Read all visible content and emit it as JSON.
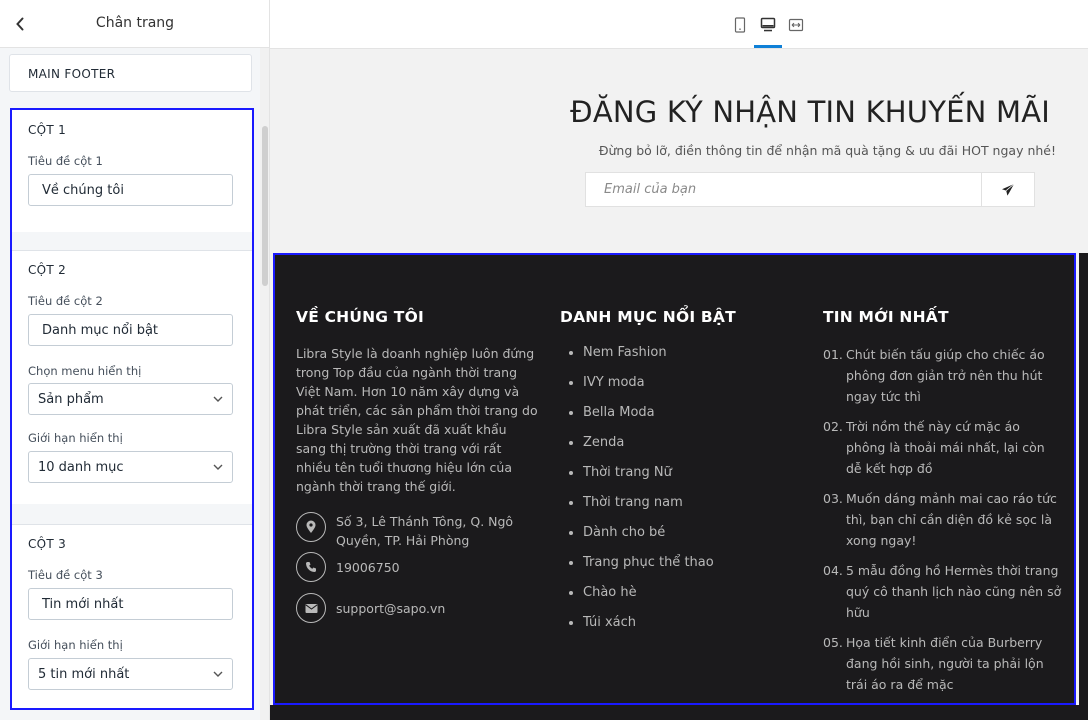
{
  "panel": {
    "title": "Chân trang",
    "main_footer_label": "MAIN FOOTER",
    "columns": [
      {
        "title": "CỘT 1",
        "title_label": "Tiêu đề cột 1",
        "title_value": "Về chúng tôi"
      },
      {
        "title": "CỘT 2",
        "title_label": "Tiêu đề cột 2",
        "title_value": "Danh mục nổi bật",
        "menu_label": "Chọn menu hiển thị",
        "menu_value": "Sản phẩm",
        "limit_label": "Giới hạn hiển thị",
        "limit_value": "10 danh mục"
      },
      {
        "title": "CỘT 3",
        "title_label": "Tiêu đề cột 3",
        "title_value": "Tin mới nhất",
        "limit_label": "Giới hạn hiển thị",
        "limit_value": "5 tin mới nhất"
      }
    ]
  },
  "device_bar": {
    "icons": [
      "mobile-icon",
      "desktop-icon",
      "fullwidth-icon"
    ],
    "active": "desktop-icon"
  },
  "newsletter": {
    "title": "ĐĂNG KÝ NHẬN TIN KHUYẾN MÃI",
    "subtitle": "Đừng bỏ lỡ, điền thông tin để nhận mã quà tặng & ưu đãi HOT ngay nhé!",
    "email_placeholder": "Email của bạn"
  },
  "footer": {
    "about": {
      "heading": "VỀ CHÚNG TÔI",
      "text": "Libra Style là doanh nghiệp luôn đứng trong Top đầu của ngành thời trang Việt Nam. Hơn 10 năm xây dựng và phát triển, các sản phẩm thời trang do Libra Style sản xuất đã xuất khẩu sang thị trường thời trang với rất nhiều tên tuổi thương hiệu lớn của ngành thời trang thế giới.",
      "address": "Số 3, Lê Thánh Tông, Q. Ngô Quyền, TP. Hải Phòng",
      "phone": "19006750",
      "email": "support@sapo.vn"
    },
    "categories": {
      "heading": "DANH MỤC NỔI BẬT",
      "items": [
        "Nem Fashion",
        "IVY moda",
        "Bella Moda",
        "Zenda",
        "Thời trang Nữ",
        "Thời trang nam",
        "Dành cho bé",
        "Trang phục thể thao",
        "Chào hè",
        "Túi xách"
      ]
    },
    "news": {
      "heading": "TIN MỚI NHẤT",
      "items": [
        {
          "num": "01.",
          "text": "Chút biến tấu giúp cho chiếc áo phông đơn giản trở nên thu hút ngay tức thì"
        },
        {
          "num": "02.",
          "text": "Trời nồm thế này cứ mặc áo phông là thoải mái nhất, lại còn dễ kết hợp đồ"
        },
        {
          "num": "03.",
          "text": "Muốn dáng mảnh mai cao ráo tức thì, bạn chỉ cần diện đồ kẻ sọc là xong ngay!"
        },
        {
          "num": "04.",
          "text": "5 mẫu đồng hồ Hermès thời trang quý cô thanh lịch nào cũng nên sở hữu"
        },
        {
          "num": "05.",
          "text": "Họa tiết kinh điển của Burberry đang hồi sinh, người ta phải lộn trái áo ra để mặc"
        }
      ]
    }
  },
  "colors": {
    "highlight_border": "#1a1aff",
    "footer_bg": "#1b1a1c",
    "active_tab": "#0f80d7"
  }
}
